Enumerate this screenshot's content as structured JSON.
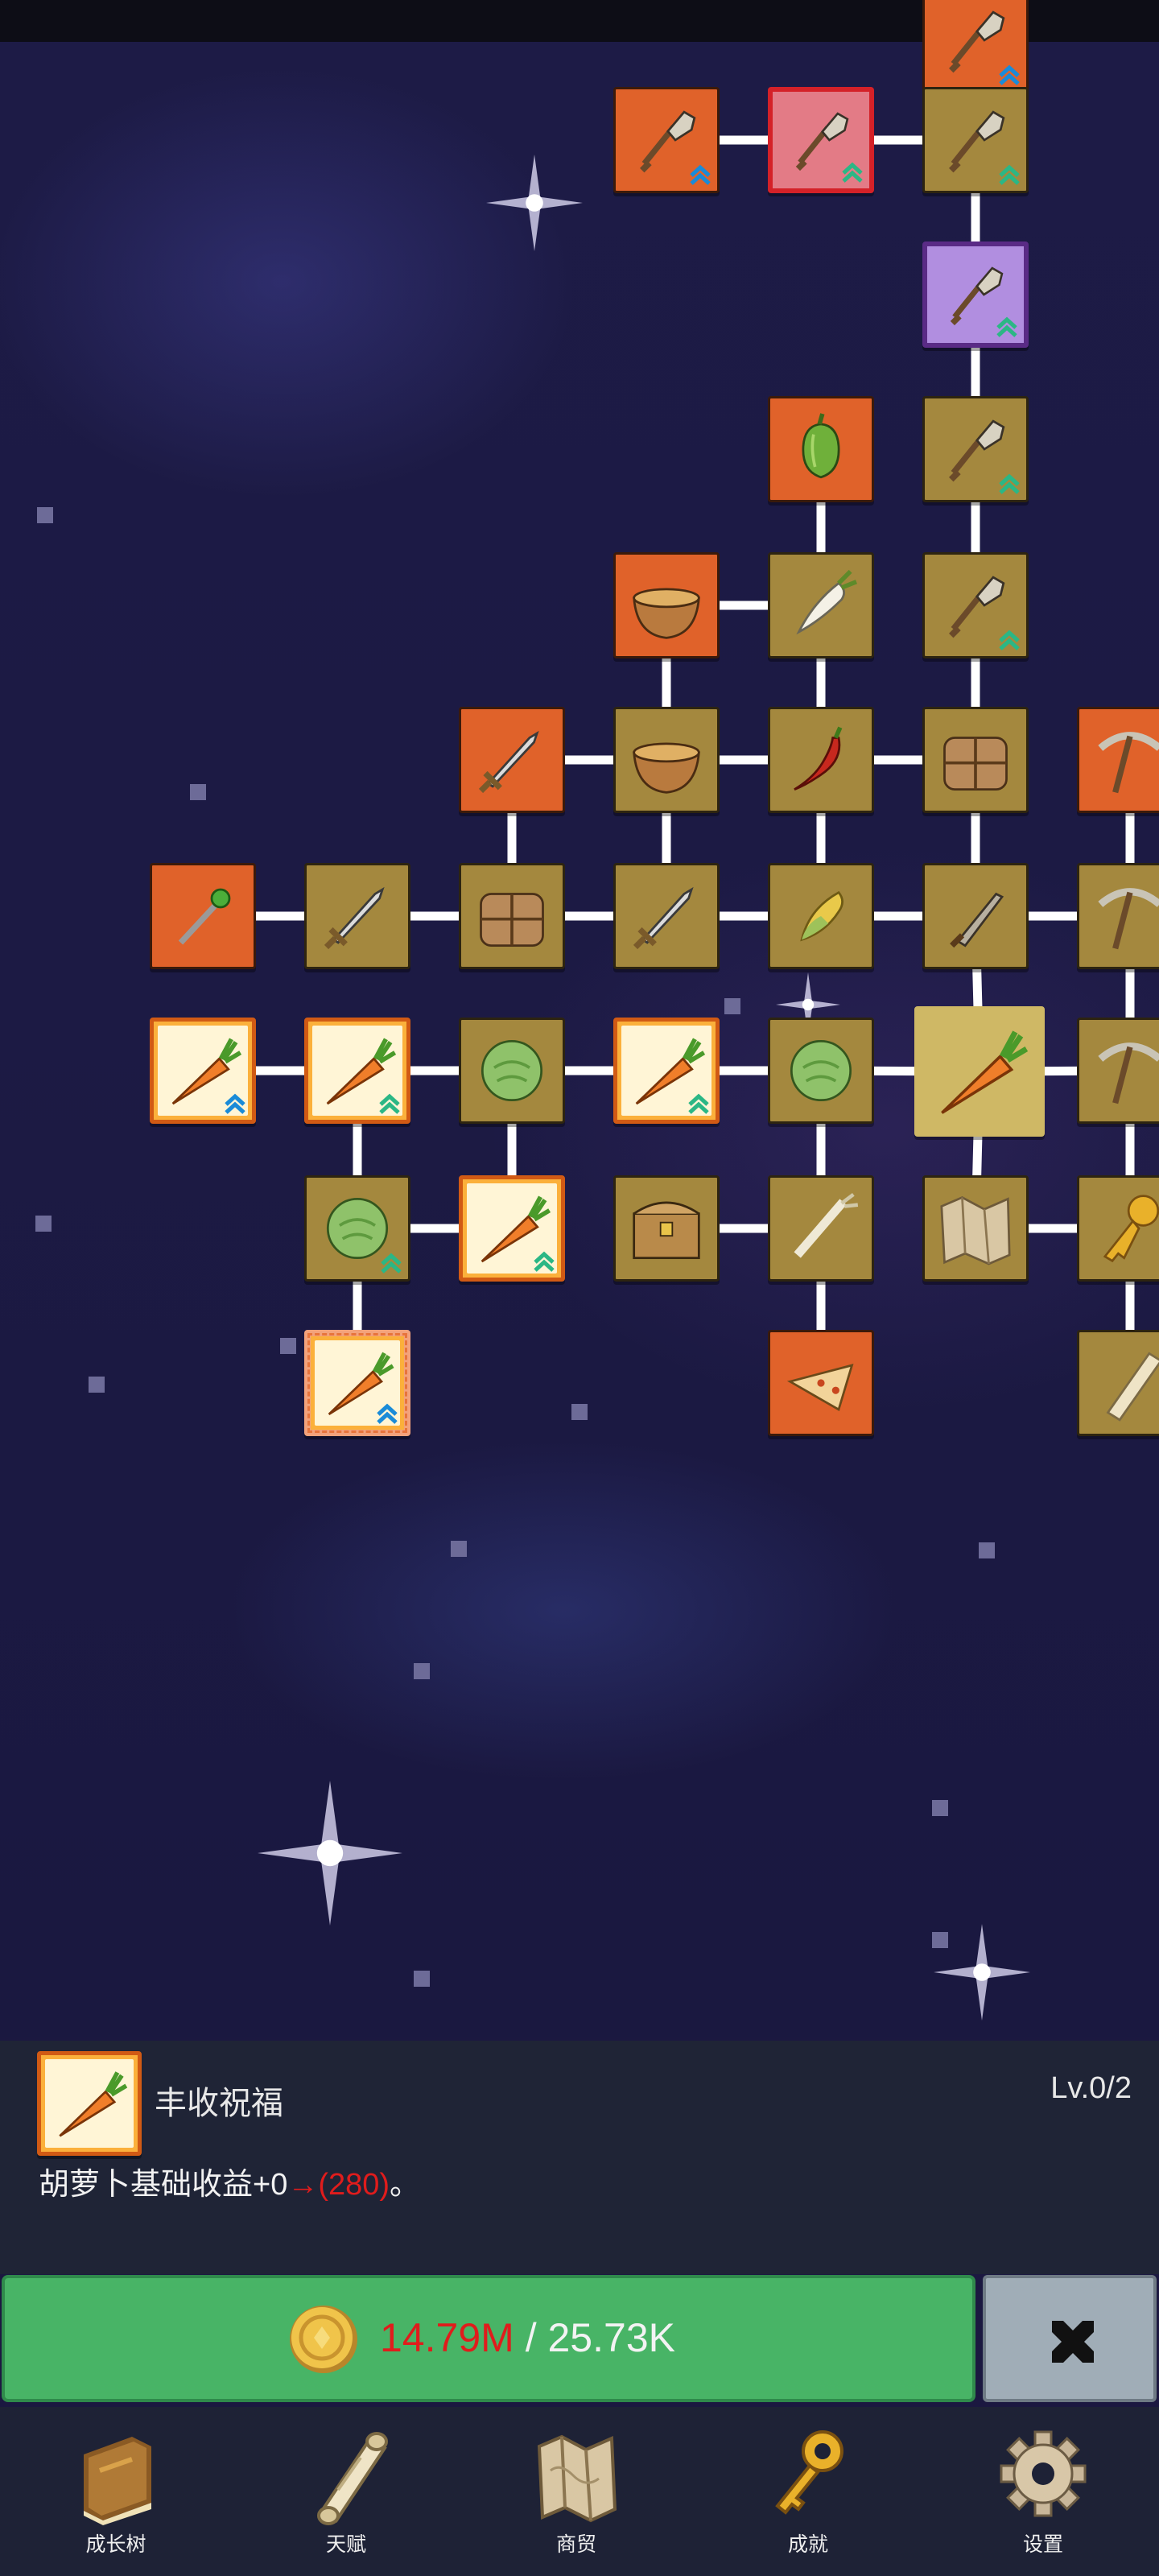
{
  "colors": {
    "node_orange": "#e0622a",
    "node_brown": "#a4883e",
    "upgrade_green": "#48b466",
    "cost_red": "#e01c1c",
    "close_gray": "#a0adb7",
    "panel_bg": "#1f2436"
  },
  "tree": {
    "nodes": [
      {
        "id": "n-top",
        "icon": "shovel-icon",
        "style": "orange",
        "level_marker": "blue"
      },
      {
        "id": "n1",
        "icon": "shovel-icon",
        "style": "orange",
        "level_marker": "blue"
      },
      {
        "id": "n2",
        "icon": "shovel-icon",
        "style": "red",
        "level_marker": "teal"
      },
      {
        "id": "n3",
        "icon": "shovel-icon",
        "style": "brown",
        "level_marker": "teal"
      },
      {
        "id": "n4",
        "icon": "shovel-icon",
        "style": "purple",
        "level_marker": "teal"
      },
      {
        "id": "n5",
        "icon": "pepper-icon",
        "style": "orange",
        "level_marker": ""
      },
      {
        "id": "n6",
        "icon": "shovel-icon",
        "style": "brown",
        "level_marker": "teal"
      },
      {
        "id": "n7",
        "icon": "bowl-icon",
        "style": "orange",
        "level_marker": ""
      },
      {
        "id": "n8",
        "icon": "radish-icon",
        "style": "brown",
        "level_marker": ""
      },
      {
        "id": "n9",
        "icon": "shovel-icon",
        "style": "brown",
        "level_marker": "teal"
      },
      {
        "id": "n10",
        "icon": "sword-icon",
        "style": "orange",
        "level_marker": ""
      },
      {
        "id": "n11",
        "icon": "bowl-icon",
        "style": "brown",
        "level_marker": ""
      },
      {
        "id": "n12",
        "icon": "chili-icon",
        "style": "brown",
        "level_marker": ""
      },
      {
        "id": "n13",
        "icon": "basket-icon",
        "style": "brown",
        "level_marker": ""
      },
      {
        "id": "n14",
        "icon": "pickaxe-icon",
        "style": "orange",
        "level_marker": ""
      },
      {
        "id": "n15",
        "icon": "staff-icon",
        "style": "orange",
        "level_marker": ""
      },
      {
        "id": "n16",
        "icon": "sword-icon",
        "style": "brown",
        "level_marker": ""
      },
      {
        "id": "n17",
        "icon": "basket-icon",
        "style": "brown",
        "level_marker": ""
      },
      {
        "id": "n18",
        "icon": "sword-icon",
        "style": "brown",
        "level_marker": ""
      },
      {
        "id": "n19",
        "icon": "corn-icon",
        "style": "brown",
        "level_marker": ""
      },
      {
        "id": "n20",
        "icon": "knife-icon",
        "style": "brown",
        "level_marker": ""
      },
      {
        "id": "n21",
        "icon": "pickaxe-icon",
        "style": "brown",
        "level_marker": ""
      },
      {
        "id": "n22",
        "icon": "carrot-icon",
        "style": "gold",
        "level_marker": "blue"
      },
      {
        "id": "n23",
        "icon": "carrot-icon",
        "style": "gold",
        "level_marker": "teal"
      },
      {
        "id": "n24",
        "icon": "cabbage-icon",
        "style": "brown",
        "level_marker": ""
      },
      {
        "id": "n25",
        "icon": "carrot-icon",
        "style": "gold",
        "level_marker": "teal"
      },
      {
        "id": "n26",
        "icon": "cabbage-icon",
        "style": "brown",
        "level_marker": ""
      },
      {
        "id": "n27",
        "icon": "carrot-icon",
        "style": "selected",
        "level_marker": ""
      },
      {
        "id": "n28",
        "icon": "pickaxe-icon",
        "style": "brown",
        "level_marker": ""
      },
      {
        "id": "n29",
        "icon": "cabbage-icon",
        "style": "brown",
        "level_marker": "teal"
      },
      {
        "id": "n30",
        "icon": "carrot-icon",
        "style": "gold",
        "level_marker": "teal"
      },
      {
        "id": "n31",
        "icon": "chest-icon",
        "style": "brown",
        "level_marker": ""
      },
      {
        "id": "n32",
        "icon": "leek-icon",
        "style": "brown",
        "level_marker": ""
      },
      {
        "id": "n33",
        "icon": "map-icon",
        "style": "brown",
        "level_marker": ""
      },
      {
        "id": "n34",
        "icon": "key-icon",
        "style": "brown",
        "level_marker": ""
      },
      {
        "id": "n35",
        "icon": "carrot-icon",
        "style": "goldpale",
        "level_marker": "blue"
      },
      {
        "id": "n36",
        "icon": "pizza-icon",
        "style": "orange",
        "level_marker": ""
      },
      {
        "id": "n37",
        "icon": "scroll-icon",
        "style": "brown",
        "level_marker": ""
      }
    ]
  },
  "detail": {
    "icon": "carrot-icon",
    "name": "丰收祝福",
    "level": "Lv.0/2",
    "desc_prefix": "胡萝卜基础收益+0",
    "desc_arrow": "→",
    "desc_next": "(280)",
    "desc_suffix": "。"
  },
  "upgrade": {
    "coin_icon": "coin-icon",
    "have": "14.79M",
    "separator": "/",
    "need": "25.73K"
  },
  "close_button": {
    "icon": "close-icon"
  },
  "nav": [
    {
      "label": "成长树",
      "icon": "book-icon"
    },
    {
      "label": "天赋",
      "icon": "scroll-icon"
    },
    {
      "label": "商贸",
      "icon": "map-icon"
    },
    {
      "label": "成就",
      "icon": "key-icon"
    },
    {
      "label": "设置",
      "icon": "gear-icon"
    }
  ]
}
